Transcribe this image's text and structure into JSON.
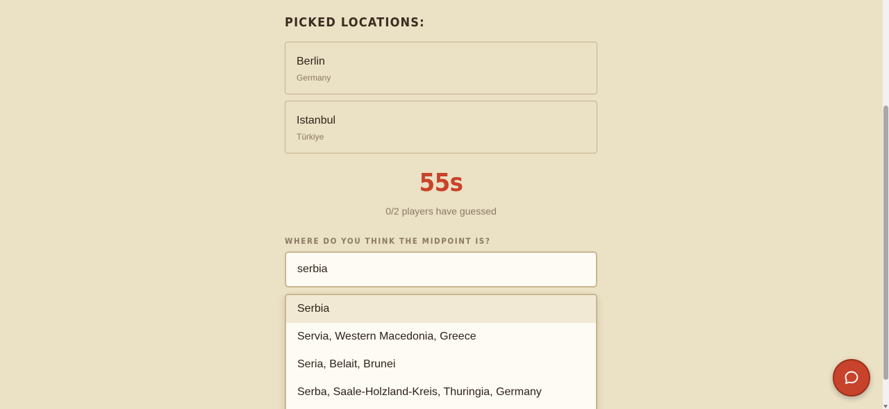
{
  "section_title": "PICKED LOCATIONS:",
  "locations": [
    {
      "name": "Berlin",
      "country": "Germany"
    },
    {
      "name": "Istanbul",
      "country": "Türkiye"
    }
  ],
  "timer": "55s",
  "guessed_status": "0/2 players have guessed",
  "question_label": "WHERE DO YOU THINK THE MIDPOINT IS?",
  "search": {
    "value": "serbia"
  },
  "suggestions": [
    "Serbia",
    "Servia, Western Macedonia, Greece",
    "Seria, Belait, Brunei",
    "Serba, Saale-Holzland-Kreis, Thuringia, Germany"
  ],
  "chat_icon": "chat-bubble-icon",
  "colors": {
    "background": "#ebe1c5",
    "accent": "#c8432b",
    "text": "#3a2c1f",
    "muted": "#8a7a63"
  }
}
